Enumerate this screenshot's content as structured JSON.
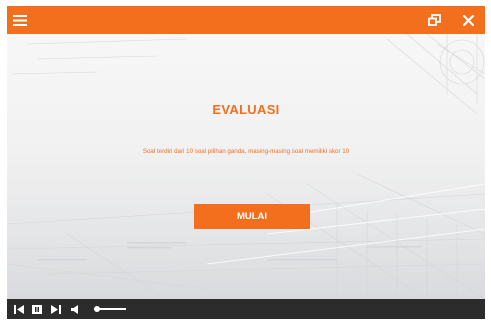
{
  "header": {
    "menu_icon": "hamburger-menu-icon",
    "restore_icon": "restore-window-icon",
    "close_icon": "close-icon"
  },
  "main": {
    "title": "EVALUASI",
    "description": "Soal terdiri dari 10 soal pilihan ganda, masing-masing soal memiliki skor 10",
    "start_label": "MULAI"
  },
  "player": {
    "controls": [
      "skip-back-icon",
      "pause-icon",
      "skip-forward-icon",
      "volume-icon"
    ],
    "volume": 0.1
  },
  "colors": {
    "accent": "#f36f1e",
    "player_bar": "#2c2c2c",
    "background": "#f2f2f2"
  }
}
